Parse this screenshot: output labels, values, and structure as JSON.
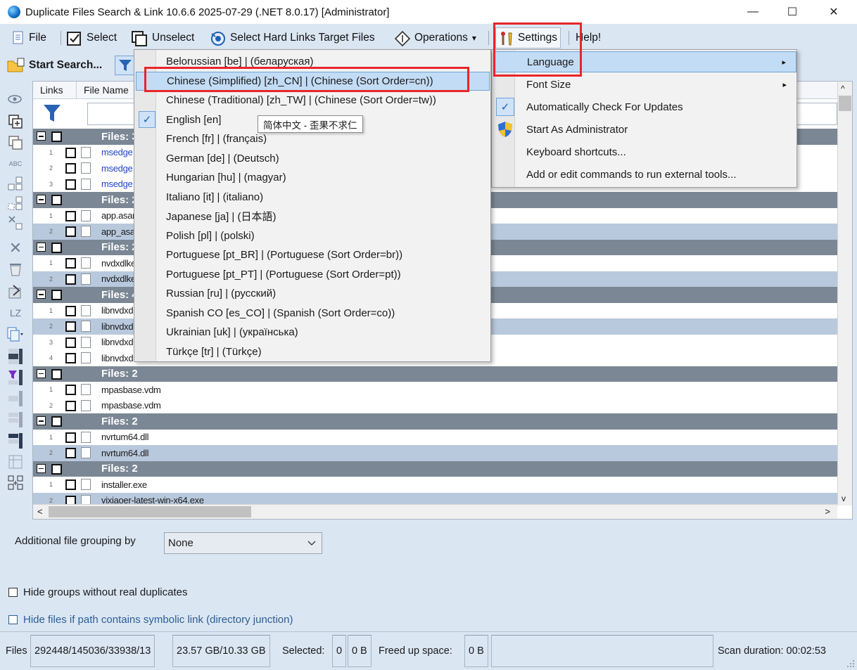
{
  "window": {
    "title": "Duplicate Files Search & Link 10.6.6 2025-07-29 (.NET 8.0.17) [Administrator]",
    "minimize": "—",
    "maximize": "☐",
    "close": "✕"
  },
  "menubar": {
    "file": "File",
    "select": "Select",
    "unselect": "Unselect",
    "select_hard_links": "Select Hard Links Target Files",
    "operations": "Operations",
    "operations_arrow": "▾",
    "settings": "Settings",
    "help": "Help!"
  },
  "toolbar": {
    "start_search": "Start Search..."
  },
  "grid": {
    "columns": [
      "Links",
      "File Name"
    ],
    "rows": [
      {
        "type": "group",
        "label": "Files: 3"
      },
      {
        "type": "file",
        "num": "1",
        "name": "msedge",
        "blue": true,
        "alt": false
      },
      {
        "type": "file",
        "num": "2",
        "name": "msedge",
        "blue": true,
        "alt": false
      },
      {
        "type": "file",
        "num": "3",
        "name": "msedge",
        "blue": true,
        "alt": false
      },
      {
        "type": "group",
        "label": "Files: 2"
      },
      {
        "type": "file",
        "num": "1",
        "name": "app.asar",
        "blue": false,
        "alt": false
      },
      {
        "type": "file",
        "num": "2",
        "name": "app_asar",
        "blue": false,
        "alt": true
      },
      {
        "type": "group",
        "label": "Files: 2"
      },
      {
        "type": "file",
        "num": "1",
        "name": "nvdxdlkernels",
        "blue": false,
        "alt": false
      },
      {
        "type": "file",
        "num": "2",
        "name": "nvdxdlkernels",
        "blue": false,
        "alt": true
      },
      {
        "type": "group",
        "label": "Files: 4"
      },
      {
        "type": "file",
        "num": "1",
        "name": "libnvdxdlkernels",
        "blue": false,
        "alt": false
      },
      {
        "type": "file",
        "num": "2",
        "name": "libnvdxdlkernels",
        "blue": false,
        "alt": true
      },
      {
        "type": "file",
        "num": "3",
        "name": "libnvdxdlkernels",
        "blue": false,
        "alt": false
      },
      {
        "type": "file",
        "num": "4",
        "name": "libnvdxdlkernels",
        "blue": false,
        "alt": false
      },
      {
        "type": "group",
        "label": "Files: 2"
      },
      {
        "type": "file",
        "num": "1",
        "name": "mpasbase.vdm",
        "blue": false,
        "alt": false
      },
      {
        "type": "file",
        "num": "2",
        "name": "mpasbase.vdm",
        "blue": false,
        "alt": false
      },
      {
        "type": "group",
        "label": "Files: 2"
      },
      {
        "type": "file",
        "num": "1",
        "name": "nvrtum64.dll",
        "blue": false,
        "alt": false
      },
      {
        "type": "file",
        "num": "2",
        "name": "nvrtum64.dll",
        "blue": false,
        "alt": true
      },
      {
        "type": "group",
        "label": "Files: 2"
      },
      {
        "type": "file",
        "num": "1",
        "name": "installer.exe",
        "blue": false,
        "alt": false
      },
      {
        "type": "file",
        "num": "2",
        "name": "vixiaoer-latest-win-x64.exe",
        "blue": false,
        "alt": true
      }
    ],
    "scroll_left": "<",
    "scroll_right": ">",
    "scroll_up": "^",
    "scroll_down": "v"
  },
  "options": {
    "grouping_label": "Additional file grouping by",
    "grouping_value": "None",
    "hide_groups": "Hide groups without real duplicates",
    "hide_symlink": "Hide files if path contains symbolic link (directory junction)"
  },
  "statusbar": {
    "files_label": "Files",
    "files_value": "292448/145036/33938/13",
    "size_value": "23.57 GB/10.33 GB",
    "selected_label": "Selected:",
    "selected_count": "0",
    "selected_size": "0 B",
    "freed_label": "Freed up space:",
    "freed_value": "0 B",
    "scan_duration": "Scan duration: 00:02:53"
  },
  "language_menu": {
    "items": [
      "Belorussian [be] | (беларуская)",
      "Chinese (Simplified) [zh_CN] | (Chinese (Sort Order=cn))",
      "Chinese (Traditional) [zh_TW] | (Chinese (Sort Order=tw))",
      "English [en]",
      "French [fr] | (français)",
      "German [de] | (Deutsch)",
      "Hungarian [hu] | (magyar)",
      "Italiano [it] | (italiano)",
      "Japanese [ja] | (日本語)",
      "Polish [pl] | (polski)",
      "Portuguese [pt_BR] | (Portuguese (Sort Order=br))",
      "Portuguese [pt_PT] | (Portuguese (Sort Order=pt))",
      "Russian [ru] | (русский)",
      "Spanish CO [es_CO] | (Spanish (Sort Order=co))",
      "Ukrainian [uk] | (українська)",
      "Türkçe [tr] | (Türkçe)"
    ],
    "highlighted_index": 1,
    "checked_index": 3,
    "tooltip": "简体中文 - 歪果不求仁"
  },
  "settings_menu": {
    "items": [
      "Language",
      "Font Size",
      "Automatically Check For Updates",
      "Start As Administrator",
      "Keyboard shortcuts...",
      "Add or edit commands to run external tools..."
    ],
    "submenu_arrow": "▸",
    "check": "✓"
  },
  "colors": {
    "accent": "#e8262b",
    "highlight": "#c3dcf5",
    "group_row": "#7b8794",
    "alt_row": "#b9c9dd"
  }
}
